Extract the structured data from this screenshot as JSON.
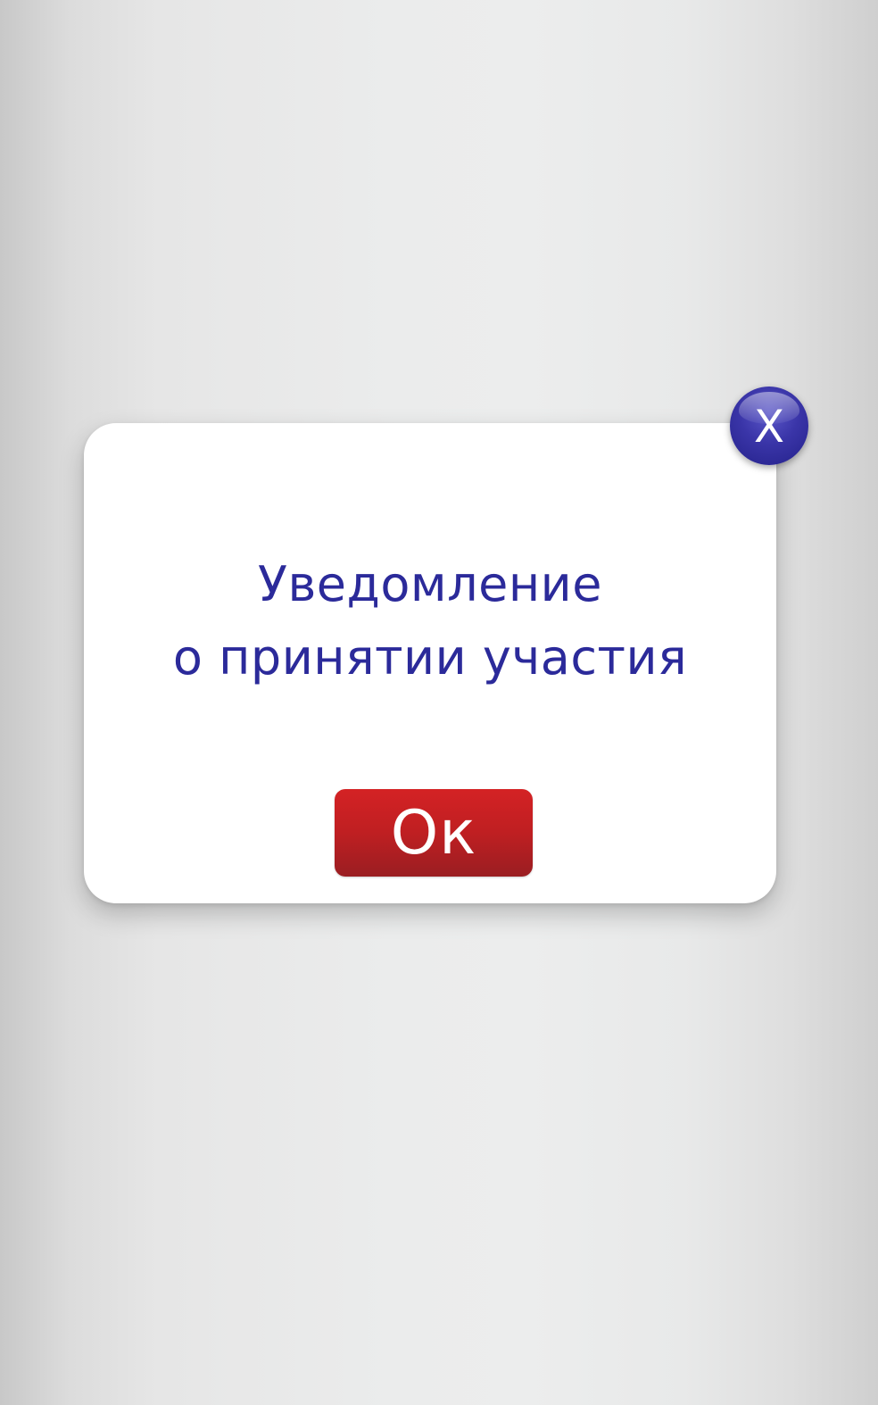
{
  "dialog": {
    "title_line1": "Уведомление",
    "title_line2": "о принятии участия",
    "ok_label": "Ок",
    "close_label": "X"
  },
  "colors": {
    "title_text": "#2b2a9a",
    "ok_button": "#c0201f",
    "close_button": "#2f2ca0"
  },
  "icons": {
    "close": "close-icon"
  }
}
